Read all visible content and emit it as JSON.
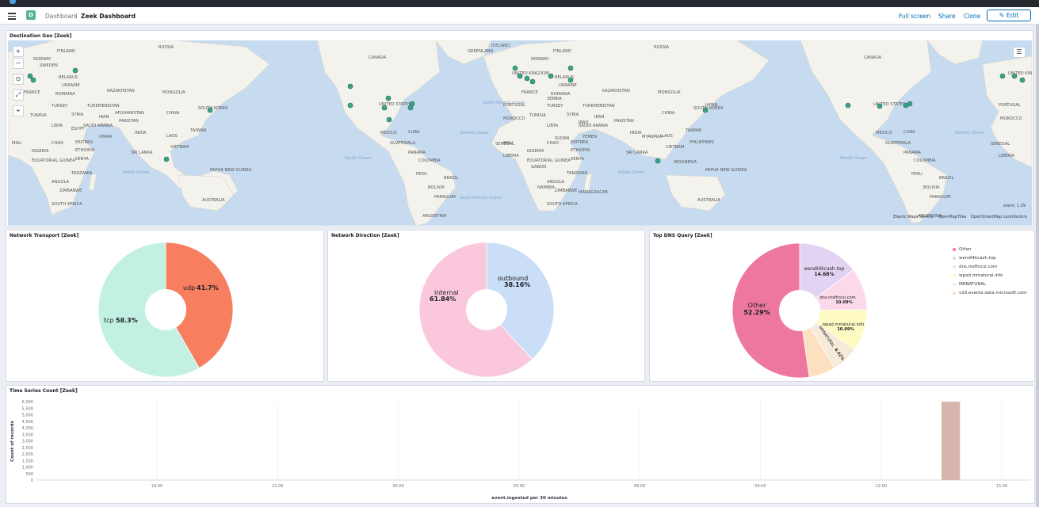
{
  "header": {
    "breadcrumb_root": "Dashboard",
    "breadcrumb_separator": "/",
    "breadcrumb_current": "Zeek Dashboard",
    "space_initial": "D",
    "full_screen_label": "Full screen",
    "share_label": "Share",
    "clone_label": "Clone",
    "edit_label": "Edit"
  },
  "map_panel": {
    "title": "Destination Geo [Zeek]",
    "zoom_readout": "zoom: 1.29",
    "attributions": [
      "Elastic Maps Service",
      "OpenMapTiles",
      "OpenStreetMap contributors"
    ],
    "country_labels": [
      "RUSSIA",
      "FINLAND",
      "NORWAY",
      "SWEDEN",
      "BELARUS",
      "UKRAINE",
      "KAZAKHSTAN",
      "MONGOLIA",
      "ROMANIA",
      "TURKEY",
      "TURKMENISTAN",
      "FRANCE",
      "SYRIA",
      "IRAN",
      "CHINA",
      "SOUTH KOREA",
      "AFGHANISTAN",
      "PAKISTAN",
      "TUNISIA",
      "LIBYA",
      "EGYPT",
      "SAUDI ARABIA",
      "OMAN",
      "INDIA",
      "TAIWAN",
      "LAOS",
      "MALI",
      "CHAD",
      "ERITREA",
      "NIGERIA",
      "ETHIOPIA",
      "VIETNAM",
      "EQUATORIAL GUINEA",
      "KENYA",
      "SRI LANKA",
      "TANZANIA",
      "PAPUA NEW GUINEA",
      "ANGOLA",
      "ZIMBABWE",
      "AUSTRALIA",
      "SOUTH AFRICA",
      "CANADA",
      "ICELAND",
      "UNITED STATES",
      "MEXICO",
      "CUBA",
      "GUATEMALA",
      "PANAMA",
      "COLOMBIA",
      "PERU",
      "BRAZIL",
      "BOLIVIA",
      "PARAGUAY",
      "ARGENTINA",
      "UNITED KINGDOM",
      "PORTUGAL",
      "MOROCCO",
      "SENEGAL",
      "LIBERIA",
      "GABON",
      "NAMIBIA",
      "MADAGASCAR",
      "SUDAN",
      "YEMEN",
      "MYANMAR",
      "INDONESIA",
      "PHILIPPINES",
      "JAPAN",
      "GREENLAND",
      "SERBIA",
      "IRAQ"
    ],
    "ocean_labels": [
      "Indian Ocean",
      "Pacific Ocean",
      "Atlantic Ocean",
      "South Atlantic Ocean",
      "North Atlantic Ocean"
    ]
  },
  "transport_panel": {
    "title": "Network Transport [Zeek]",
    "slices": [
      {
        "name": "udp",
        "pct_label": "41.7%",
        "value": 41.7,
        "color": "#f77e5e"
      },
      {
        "name": "tcp",
        "pct_label": "58.3%",
        "value": 58.3,
        "color": "#c2f0e2"
      }
    ]
  },
  "direction_panel": {
    "title": "Network Direction [Zeek]",
    "slices": [
      {
        "name": "outbound",
        "pct_label": "38.16%",
        "value": 38.16,
        "color": "#cadff7"
      },
      {
        "name": "internal",
        "pct_label": "61.84%",
        "value": 61.84,
        "color": "#fac7dd"
      }
    ]
  },
  "dns_panel": {
    "title": "Top DNS Query [Zeek]",
    "slices": [
      {
        "name": "wendi4kcash.top",
        "pct_label": "14.68%",
        "value": 14.68,
        "color": "#e2d3f2"
      },
      {
        "name": "dns.msftncsi.com",
        "pct_label": "10.09%",
        "value": 10.09,
        "color": "#fcd9ea"
      },
      {
        "name": "wpad.mmatural.info",
        "pct_label": "10.09%",
        "value": 10.09,
        "color": "#fdfac2"
      },
      {
        "name": "MRNATURAL",
        "pct_label": "6.42%",
        "value": 6.42,
        "color": "#f6ebd9"
      },
      {
        "name": "v10.events.data.microsoft.com",
        "pct_label": "",
        "value": 6.43,
        "color": "#fde0bf"
      },
      {
        "name": "Other",
        "pct_label": "52.29%",
        "value": 52.29,
        "color": "#ee789d"
      }
    ],
    "legend": [
      {
        "label": "Other",
        "color": "#ee789d"
      },
      {
        "label": "wendi4kcash.top",
        "color": "#e2d3f2"
      },
      {
        "label": "dns.msftncsi.com",
        "color": "#fcd9ea"
      },
      {
        "label": "wpad.mmatural.info",
        "color": "#fdfac2"
      },
      {
        "label": "MRNATURAL",
        "color": "#f6ebd9"
      },
      {
        "label": "v10.events.data.microsoft.com",
        "color": "#fde0bf"
      }
    ]
  },
  "ts_panel": {
    "title": "Time Series Count [Zeek]"
  },
  "chart_data": [
    {
      "type": "pie",
      "title": "Network Transport [Zeek]",
      "categories": [
        "udp",
        "tcp"
      ],
      "values": [
        41.7,
        58.3
      ]
    },
    {
      "type": "pie",
      "title": "Network Direction [Zeek]",
      "categories": [
        "outbound",
        "internal"
      ],
      "values": [
        38.16,
        61.84
      ]
    },
    {
      "type": "pie",
      "title": "Top DNS Query [Zeek]",
      "categories": [
        "wendi4kcash.top",
        "dns.msftncsi.com",
        "wpad.mmatural.info",
        "MRNATURAL",
        "v10.events.data.microsoft.com",
        "Other"
      ],
      "values": [
        14.68,
        10.09,
        10.09,
        6.42,
        6.43,
        52.29
      ]
    },
    {
      "type": "bar",
      "title": "Time Series Count [Zeek]",
      "xlabel": "event.ingested per 30 minutes",
      "ylabel": "Count of records",
      "x_ticks": [
        "18:00",
        "21:00",
        "00:00",
        "03:00",
        "06:00",
        "09:00",
        "12:00",
        "15:00"
      ],
      "y_ticks": [
        "0",
        "500",
        "1,000",
        "1,500",
        "2,000",
        "2,500",
        "3,000",
        "3,500",
        "4,000",
        "4,500",
        "5,000",
        "5,500",
        "6,000"
      ],
      "ylim": [
        0,
        6000
      ],
      "bars": [
        {
          "x": "13:30",
          "value": 6000,
          "color": "#d6b5ad"
        }
      ]
    }
  ]
}
